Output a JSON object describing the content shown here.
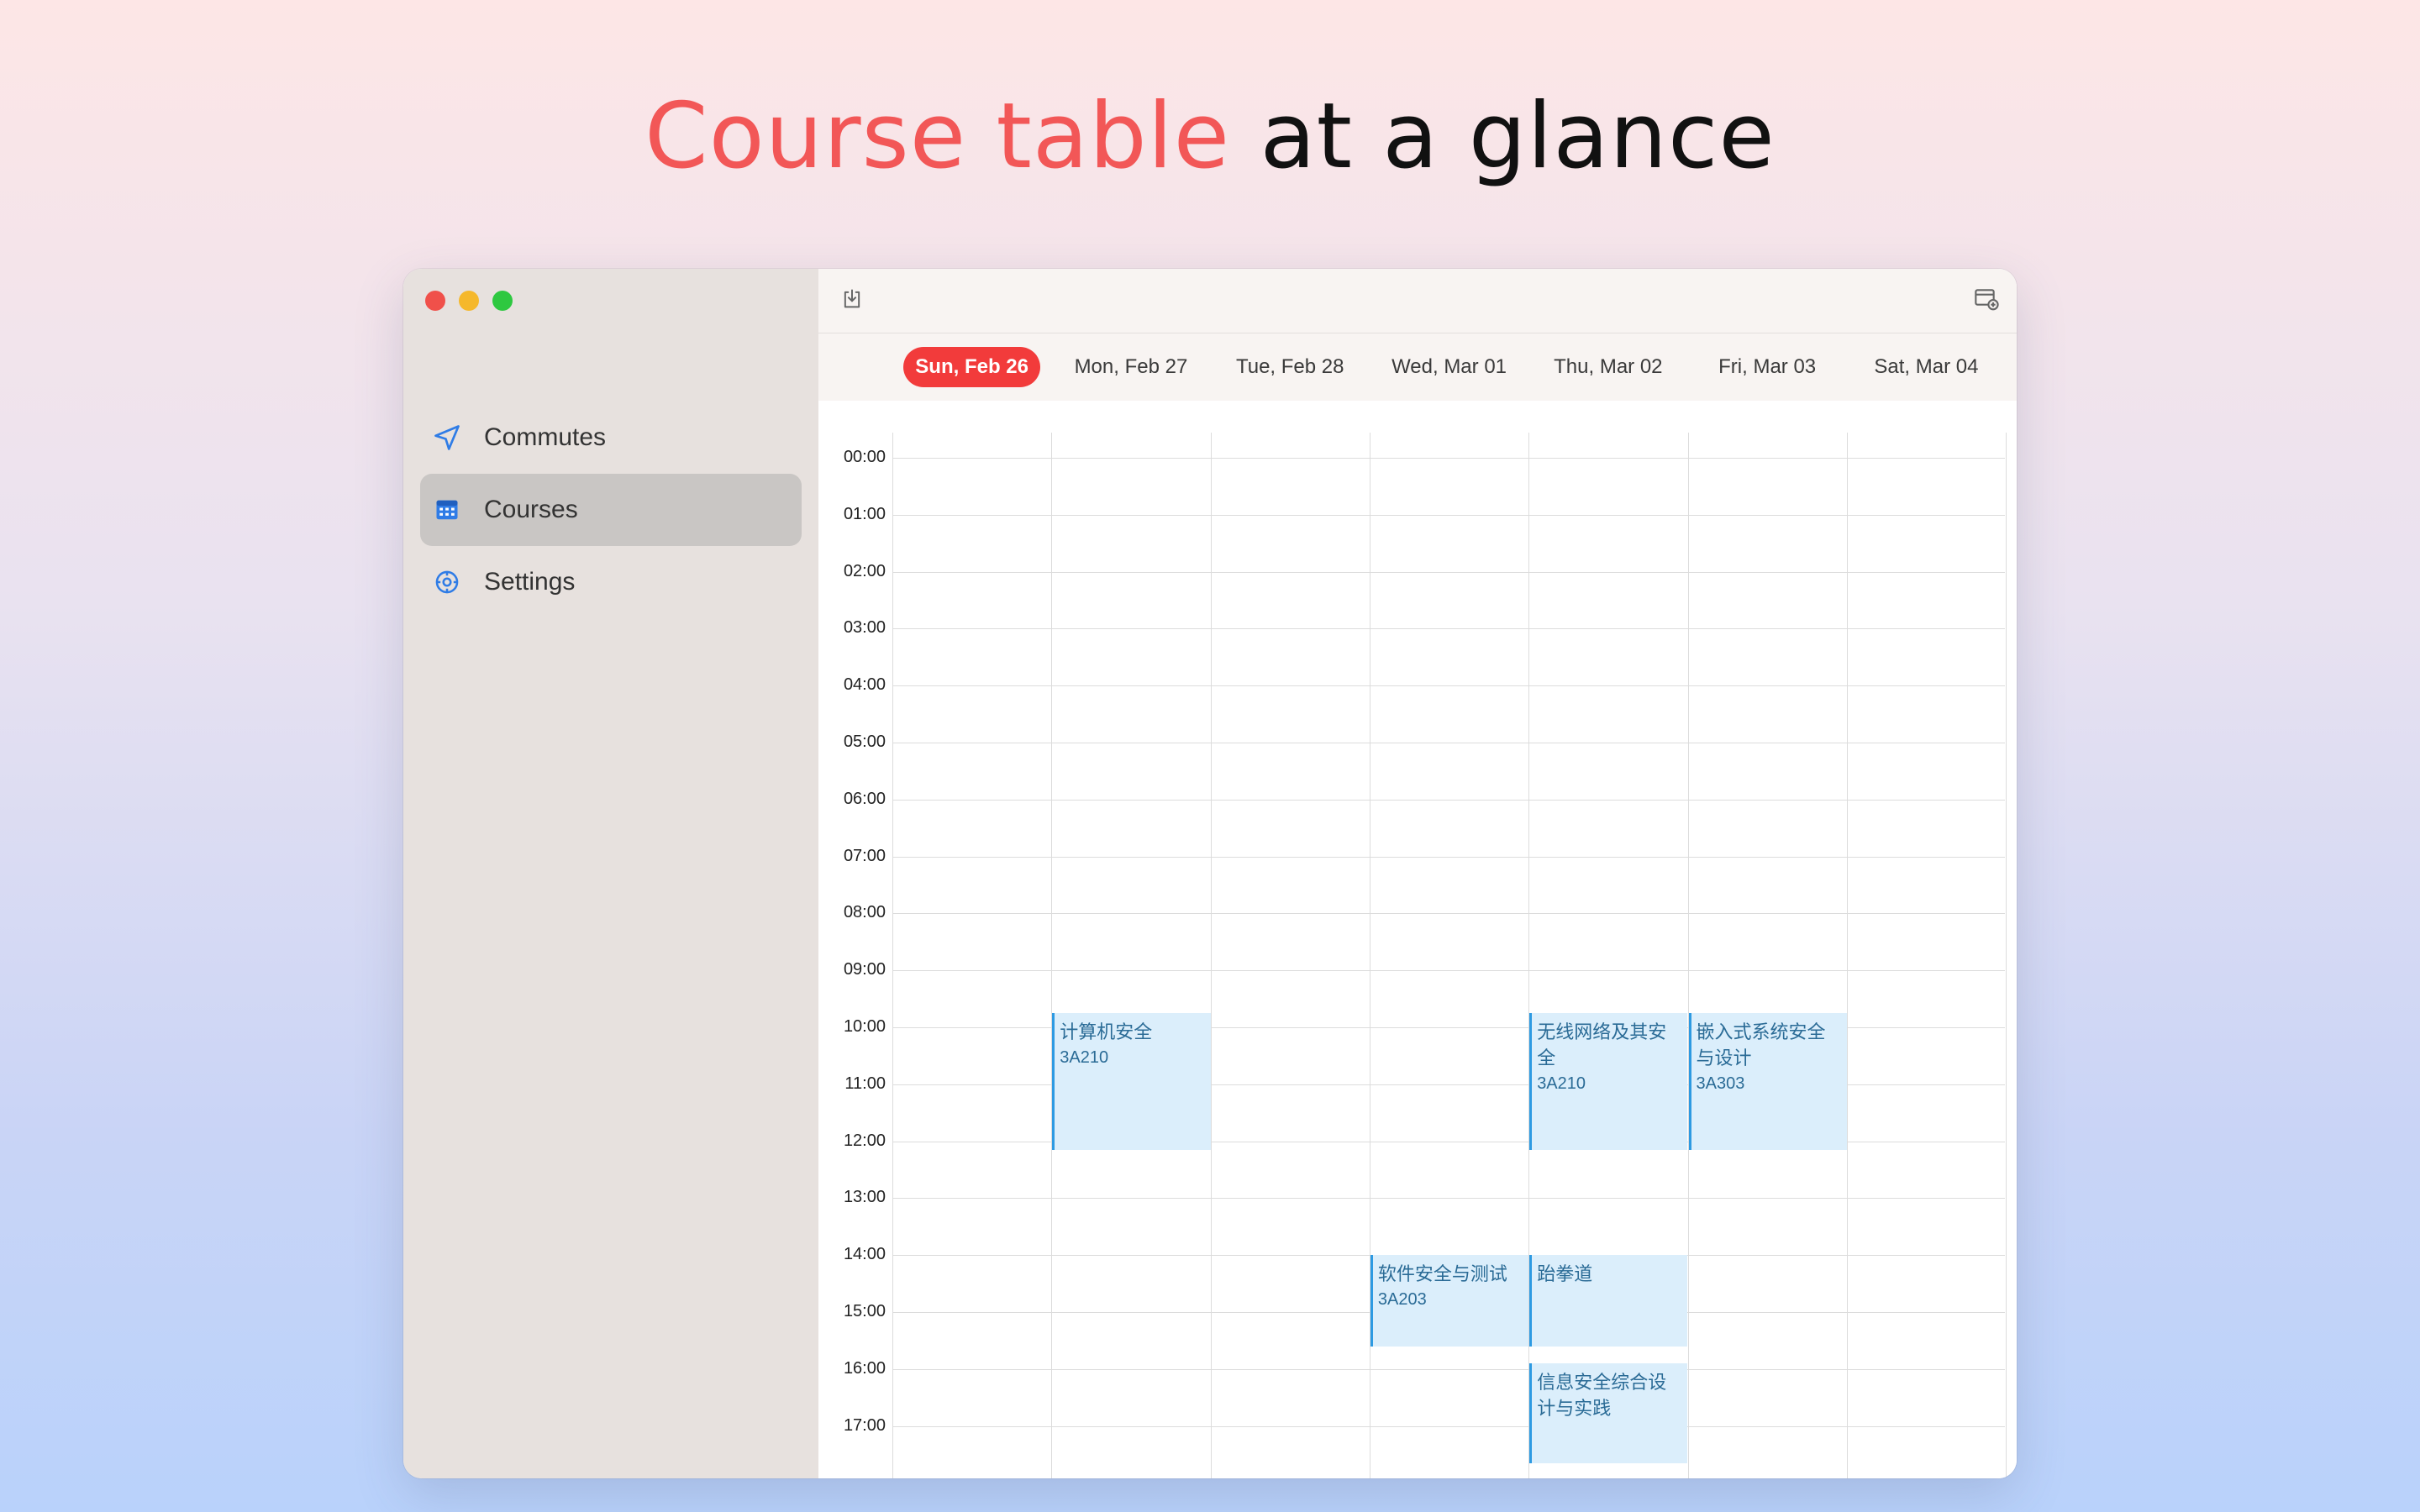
{
  "headline": {
    "accent": "Course table",
    "rest": "at a glance"
  },
  "sidebar": {
    "items": [
      {
        "label": "Commutes",
        "icon": "location-arrow-icon"
      },
      {
        "label": "Courses",
        "icon": "calendar-icon",
        "active": true
      },
      {
        "label": "Settings",
        "icon": "gear-icon"
      }
    ]
  },
  "toolbar": {
    "left_icon": "import-icon",
    "right_icon": "calendar-add-icon"
  },
  "days": [
    "Sun, Feb 26",
    "Mon, Feb 27",
    "Tue, Feb 28",
    "Wed, Mar 01",
    "Thu, Mar 02",
    "Fri, Mar 03",
    "Sat, Mar 04"
  ],
  "today_index": 0,
  "hours": [
    "00:00",
    "01:00",
    "02:00",
    "03:00",
    "04:00",
    "05:00",
    "06:00",
    "07:00",
    "08:00",
    "09:00",
    "10:00",
    "11:00",
    "12:00",
    "13:00",
    "14:00",
    "15:00",
    "16:00",
    "17:00"
  ],
  "events": [
    {
      "title": "计算机安全",
      "room": "3A210",
      "day": 1,
      "start": 9.75,
      "end": 12.15
    },
    {
      "title": "无线网络及其安全",
      "room": "3A210",
      "day": 4,
      "start": 9.75,
      "end": 12.15
    },
    {
      "title": "嵌入式系统安全与设计",
      "room": "3A303",
      "day": 5,
      "start": 9.75,
      "end": 12.15
    },
    {
      "title": "软件安全与测试",
      "room": "3A203",
      "day": 3,
      "start": 14.0,
      "end": 15.6
    },
    {
      "title": "跆拳道",
      "room": "",
      "day": 4,
      "start": 14.0,
      "end": 15.6
    },
    {
      "title": "信息安全综合设计与实践",
      "room": "",
      "day": 4,
      "start": 15.9,
      "end": 17.65
    }
  ],
  "colors": {
    "accent": "#f25757",
    "today": "#f23b3b",
    "event_bg": "#dbeefb",
    "event_border": "#2d9ae2",
    "event_text": "#2a6b96"
  }
}
